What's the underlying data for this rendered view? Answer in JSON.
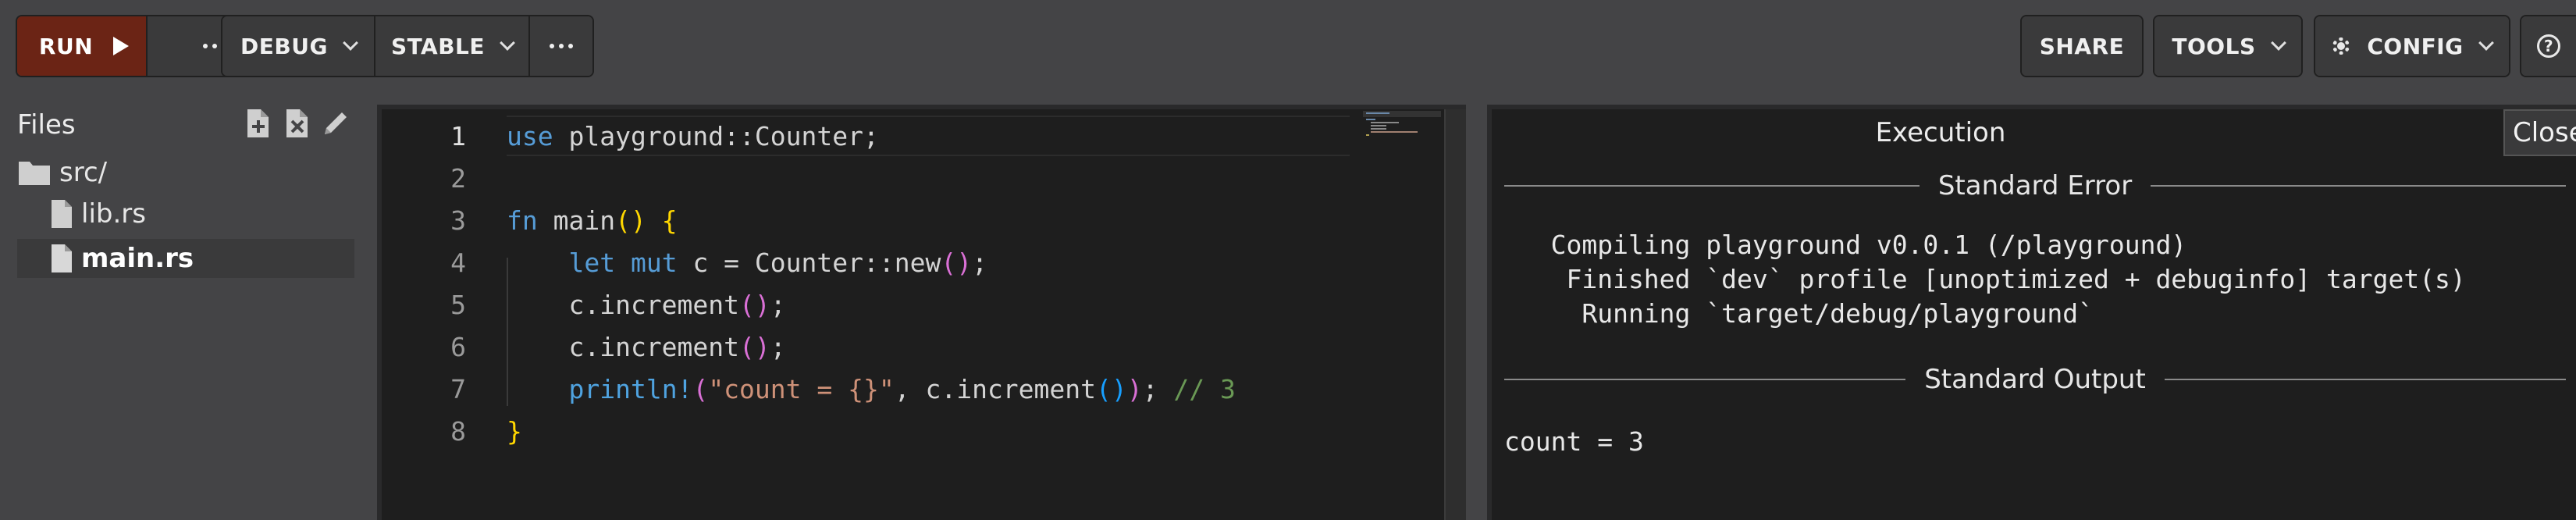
{
  "toolbar": {
    "run_label": "RUN",
    "mode_label": "DEBUG",
    "channel_label": "STABLE",
    "share_label": "SHARE",
    "tools_label": "TOOLS",
    "config_label": "CONFIG",
    "help_label": "?"
  },
  "files": {
    "title": "Files",
    "tree": [
      {
        "name": "src/",
        "kind": "folder"
      },
      {
        "name": "lib.rs",
        "kind": "file"
      },
      {
        "name": "main.rs",
        "kind": "file",
        "selected": true
      }
    ]
  },
  "editor": {
    "lines": [
      {
        "no": "1",
        "tokens": [
          {
            "t": "use",
            "c": "kw"
          },
          {
            "t": " playground::Counter;"
          }
        ]
      },
      {
        "no": "2",
        "tokens": []
      },
      {
        "no": "3",
        "tokens": [
          {
            "t": "fn",
            "c": "kw"
          },
          {
            "t": " main"
          },
          {
            "t": "()",
            "c": "p1"
          },
          {
            "t": " "
          },
          {
            "t": "{",
            "c": "p1"
          }
        ]
      },
      {
        "no": "4",
        "tokens": [
          {
            "t": "    "
          },
          {
            "t": "let",
            "c": "kw"
          },
          {
            "t": " "
          },
          {
            "t": "mut",
            "c": "kw"
          },
          {
            "t": " c = Counter::new"
          },
          {
            "t": "()",
            "c": "p2"
          },
          {
            "t": ";"
          }
        ]
      },
      {
        "no": "5",
        "tokens": [
          {
            "t": "    c.increment"
          },
          {
            "t": "()",
            "c": "p2"
          },
          {
            "t": ";"
          }
        ]
      },
      {
        "no": "6",
        "tokens": [
          {
            "t": "    c.increment"
          },
          {
            "t": "()",
            "c": "p2"
          },
          {
            "t": ";"
          }
        ]
      },
      {
        "no": "7",
        "tokens": [
          {
            "t": "    "
          },
          {
            "t": "println!",
            "c": "mac"
          },
          {
            "t": "(",
            "c": "p2"
          },
          {
            "t": "\"count = {}\"",
            "c": "str"
          },
          {
            "t": ", c.increment"
          },
          {
            "t": "()",
            "c": "p3"
          },
          {
            "t": ")",
            "c": "p2"
          },
          {
            "t": "; "
          },
          {
            "t": "// 3",
            "c": "cmt"
          }
        ]
      },
      {
        "no": "8",
        "tokens": [
          {
            "t": "}",
            "c": "p1"
          }
        ]
      }
    ]
  },
  "output": {
    "title": "Execution",
    "close_label": "Close",
    "stderr_label": "Standard Error",
    "stderr_lines": [
      "   Compiling playground v0.0.1 (/playground)",
      "    Finished `dev` profile [unoptimized + debuginfo] target(s)",
      "     Running `target/debug/playground`"
    ],
    "stdout_label": "Standard Output",
    "stdout_lines": [
      "count = 3"
    ]
  },
  "colors": {
    "run_button": "#6b2415",
    "keyword": "#569cd6",
    "string": "#ce9178",
    "comment": "#6a9955",
    "bracket_1": "#ffd700",
    "bracket_2": "#da70d6",
    "bracket_3": "#179fff"
  },
  "icons": [
    "play-icon",
    "more-icon",
    "chevron-down-icon",
    "gear-icon",
    "help-icon",
    "new-file-icon",
    "delete-file-icon",
    "rename-icon",
    "folder-icon",
    "file-icon"
  ]
}
